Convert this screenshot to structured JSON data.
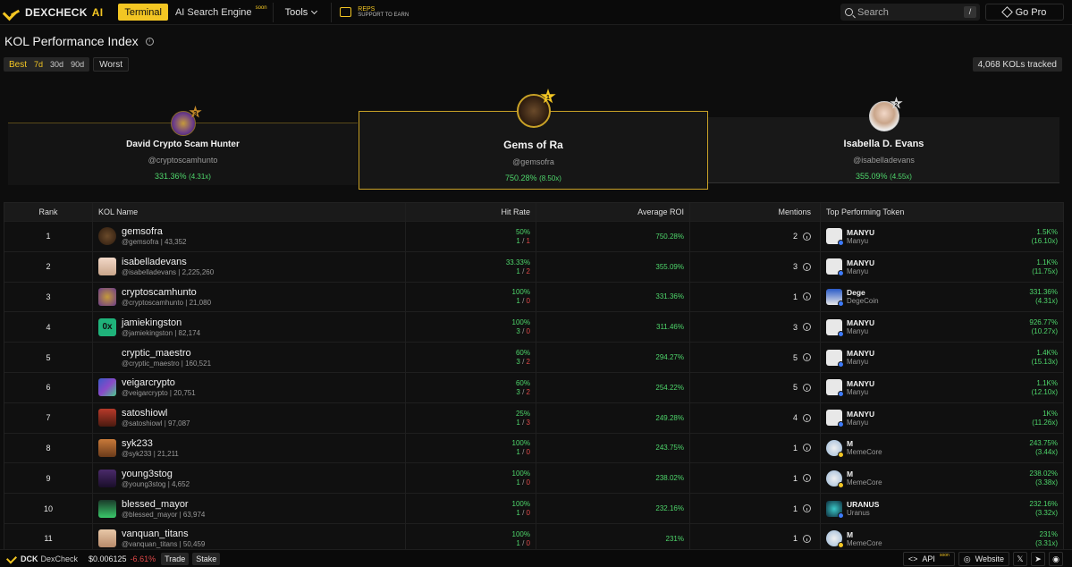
{
  "nav": {
    "brand": "DEXCHECK",
    "brand_ai": "AI",
    "terminal": "Terminal",
    "search_engine": "AI Search Engine",
    "search_engine_badge": "soon",
    "tools": "Tools",
    "reps_title": "REPS",
    "reps_sub": "SUPPORT TO EARN",
    "search_placeholder": "Search",
    "search_shortcut": "/",
    "go_pro": "Go Pro"
  },
  "page": {
    "title": "KOL Performance Index",
    "info": "i",
    "filter_best": "Best",
    "filter_7d": "7d",
    "filter_30d": "30d",
    "filter_90d": "90d",
    "filter_worst": "Worst",
    "tracked": "4,068 KOLs tracked"
  },
  "podium": {
    "first": {
      "rank": "1",
      "name": "Gems of Ra",
      "handle": "@gemsofra",
      "roi": "750.28%",
      "mult": "(8.50x)"
    },
    "second": {
      "rank": "2",
      "name": "Isabella D. Evans",
      "handle": "@isabelladevans",
      "roi": "355.09%",
      "mult": "(4.55x)"
    },
    "third": {
      "rank": "3",
      "name": "David Crypto Scam Hunter",
      "handle": "@cryptoscamhunto",
      "roi": "331.36%",
      "mult": "(4.31x)"
    }
  },
  "table": {
    "headers": {
      "rank": "Rank",
      "name": "KOL Name",
      "hit": "Hit Rate",
      "roi": "Average ROI",
      "mentions": "Mentions",
      "token": "Top Performing Token"
    },
    "rows": [
      {
        "rank": "1",
        "name": "gemsofra",
        "sub": "@gemsofra | 43,352",
        "hit": "50%",
        "w": "1",
        "l": "1",
        "roi": "750.28%",
        "mentions": "2",
        "token": "MANYU",
        "token_sub": "Manyu",
        "token_roi": "1.5K%",
        "token_mult": "(16.10x)"
      },
      {
        "rank": "2",
        "name": "isabelladevans",
        "sub": "@isabelladevans | 2,225,260",
        "hit": "33.33%",
        "w": "1",
        "l": "2",
        "roi": "355.09%",
        "mentions": "3",
        "token": "MANYU",
        "token_sub": "Manyu",
        "token_roi": "1.1K%",
        "token_mult": "(11.75x)"
      },
      {
        "rank": "3",
        "name": "cryptoscamhunto",
        "sub": "@cryptoscamhunto | 21,080",
        "hit": "100%",
        "w": "1",
        "l": "0",
        "roi": "331.36%",
        "mentions": "1",
        "token": "Dege",
        "token_sub": "DegeCoin",
        "token_roi": "331.36%",
        "token_mult": "(4.31x)"
      },
      {
        "rank": "4",
        "name": "jamiekingston",
        "sub": "@jamiekingston | 82,174",
        "hit": "100%",
        "w": "3",
        "l": "0",
        "roi": "311.46%",
        "mentions": "3",
        "token": "MANYU",
        "token_sub": "Manyu",
        "token_roi": "926.77%",
        "token_mult": "(10.27x)"
      },
      {
        "rank": "5",
        "name": "cryptic_maestro",
        "sub": "@cryptic_maestro | 160,521",
        "hit": "60%",
        "w": "3",
        "l": "2",
        "roi": "294.27%",
        "mentions": "5",
        "token": "MANYU",
        "token_sub": "Manyu",
        "token_roi": "1.4K%",
        "token_mult": "(15.13x)"
      },
      {
        "rank": "6",
        "name": "veigarcrypto",
        "sub": "@veigarcrypto | 20,751",
        "hit": "60%",
        "w": "3",
        "l": "2",
        "roi": "254.22%",
        "mentions": "5",
        "token": "MANYU",
        "token_sub": "Manyu",
        "token_roi": "1.1K%",
        "token_mult": "(12.10x)"
      },
      {
        "rank": "7",
        "name": "satoshiowl",
        "sub": "@satoshiowl | 97,087",
        "hit": "25%",
        "w": "1",
        "l": "3",
        "roi": "249.28%",
        "mentions": "4",
        "token": "MANYU",
        "token_sub": "Manyu",
        "token_roi": "1K%",
        "token_mult": "(11.26x)"
      },
      {
        "rank": "8",
        "name": "syk233",
        "sub": "@syk233 | 21,211",
        "hit": "100%",
        "w": "1",
        "l": "0",
        "roi": "243.75%",
        "mentions": "1",
        "token": "M",
        "token_sub": "MemeCore",
        "token_roi": "243.75%",
        "token_mult": "(3.44x)"
      },
      {
        "rank": "9",
        "name": "young3stog",
        "sub": "@young3stog | 4,652",
        "hit": "100%",
        "w": "1",
        "l": "0",
        "roi": "238.02%",
        "mentions": "1",
        "token": "M",
        "token_sub": "MemeCore",
        "token_roi": "238.02%",
        "token_mult": "(3.38x)"
      },
      {
        "rank": "10",
        "name": "blessed_mayor",
        "sub": "@blessed_mayor | 63,974",
        "hit": "100%",
        "w": "1",
        "l": "0",
        "roi": "232.16%",
        "mentions": "1",
        "token": "URANUS",
        "token_sub": "Uranus",
        "token_roi": "232.16%",
        "token_mult": "(3.32x)"
      },
      {
        "rank": "11",
        "name": "vanquan_titans",
        "sub": "@vanquan_titans | 50,459",
        "hit": "100%",
        "w": "1",
        "l": "0",
        "roi": "231%",
        "mentions": "1",
        "token": "M",
        "token_sub": "MemeCore",
        "token_roi": "231%",
        "token_mult": "(3.31x)"
      }
    ]
  },
  "footer": {
    "ticker": "DCK",
    "name": "DexCheck",
    "price": "$0.006125",
    "change": "-6.61%",
    "trade": "Trade",
    "stake": "Stake",
    "api": "API",
    "api_badge": "soon",
    "website": "Website"
  },
  "colors": {
    "accent": "#f3c623",
    "positive": "#4ed66b",
    "negative": "#e04848"
  }
}
